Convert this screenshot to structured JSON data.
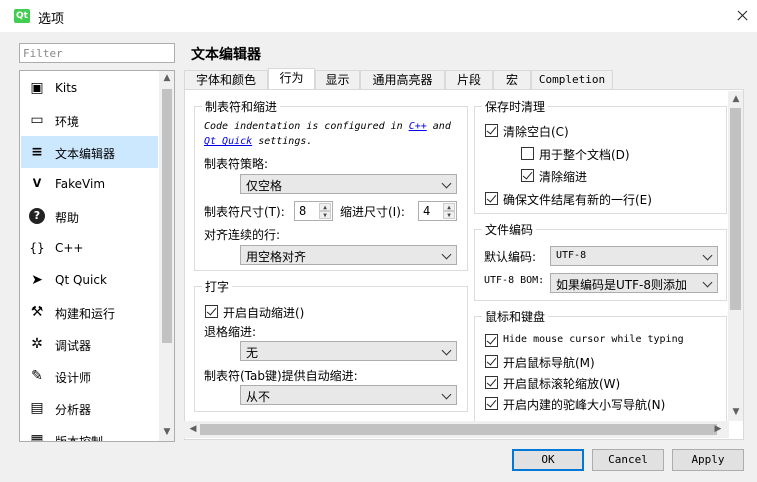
{
  "window": {
    "title": "选项",
    "app_icon": "qt-logo-icon"
  },
  "filter": {
    "placeholder": "Filter"
  },
  "sidebar": {
    "items": [
      {
        "label": "Kits",
        "icon": "kits-icon",
        "glyph": "▣"
      },
      {
        "label": "环境",
        "icon": "monitor-icon",
        "glyph": "▭"
      },
      {
        "label": "文本编辑器",
        "icon": "text-editor-icon",
        "glyph": "≡",
        "selected": true
      },
      {
        "label": "FakeVim",
        "icon": "fakevim-icon",
        "glyph": "ᐯ"
      },
      {
        "label": "帮助",
        "icon": "help-icon",
        "glyph": "?"
      },
      {
        "label": "C++",
        "icon": "braces-icon",
        "glyph": "{}"
      },
      {
        "label": "Qt Quick",
        "icon": "qtquick-icon",
        "glyph": "➤"
      },
      {
        "label": "构建和运行",
        "icon": "hammer-icon",
        "glyph": "⚒"
      },
      {
        "label": "调试器",
        "icon": "bug-icon",
        "glyph": "✲"
      },
      {
        "label": "设计师",
        "icon": "pencil-icon",
        "glyph": "✎"
      },
      {
        "label": "分析器",
        "icon": "analyzer-icon",
        "glyph": "▤"
      },
      {
        "label": "版本控制",
        "icon": "version-control-icon",
        "glyph": "▦"
      }
    ]
  },
  "page_title": "文本编辑器",
  "tabs": [
    {
      "label": "字体和颜色"
    },
    {
      "label": "行为",
      "active": true
    },
    {
      "label": "显示"
    },
    {
      "label": "通用高亮器"
    },
    {
      "label": "片段"
    },
    {
      "label": "宏"
    },
    {
      "label": "Completion"
    }
  ],
  "tabs_indent": {
    "title": "制表符和缩进",
    "info_part1": "Code indentation is configured in ",
    "info_link1": "C++",
    "info_part2": " and",
    "info_link2": "Qt Quick",
    "info_part3": " settings.",
    "policy_label": "制表符策略:",
    "policy_value": "仅空格",
    "tab_size_label": "制表符尺寸(T):",
    "tab_size_value": "8",
    "indent_size_label": "缩进尺寸(I):",
    "indent_size_value": "4",
    "align_label": "对齐连续的行:",
    "align_value": "用空格对齐"
  },
  "typing": {
    "title": "打字",
    "auto_indent_label": "开启自动缩进()",
    "auto_indent_checked": true,
    "backspace_label": "退格缩进:",
    "backspace_value": "无",
    "tab_key_label": "制表符(Tab键)提供自动缩进:",
    "tab_key_value": "从不"
  },
  "cleanup": {
    "title": "保存时清理",
    "clean_ws_label": "清除空白(C)",
    "clean_ws_checked": true,
    "entire_doc_label": "用于整个文档(D)",
    "entire_doc_checked": false,
    "clean_indent_label": "清除缩进",
    "clean_indent_checked": true,
    "newline_label": "确保文件结尾有新的一行(E)",
    "newline_checked": true
  },
  "encoding": {
    "title": "文件编码",
    "default_label": "默认编码:",
    "default_value": "UTF-8",
    "bom_label": "UTF-8 BOM:",
    "bom_value": "如果编码是UTF-8则添加"
  },
  "mouse": {
    "title": "鼠标和键盘",
    "items": [
      {
        "label": "Hide mouse cursor while typing",
        "checked": true
      },
      {
        "label": "开启鼠标导航(M)",
        "checked": true
      },
      {
        "label": "开启鼠标滚轮缩放(W)",
        "checked": true
      },
      {
        "label": "开启内建的驼峰大小写导航(N)",
        "checked": true
      }
    ]
  },
  "buttons": {
    "ok": "OK",
    "cancel": "Cancel",
    "apply": "Apply"
  }
}
